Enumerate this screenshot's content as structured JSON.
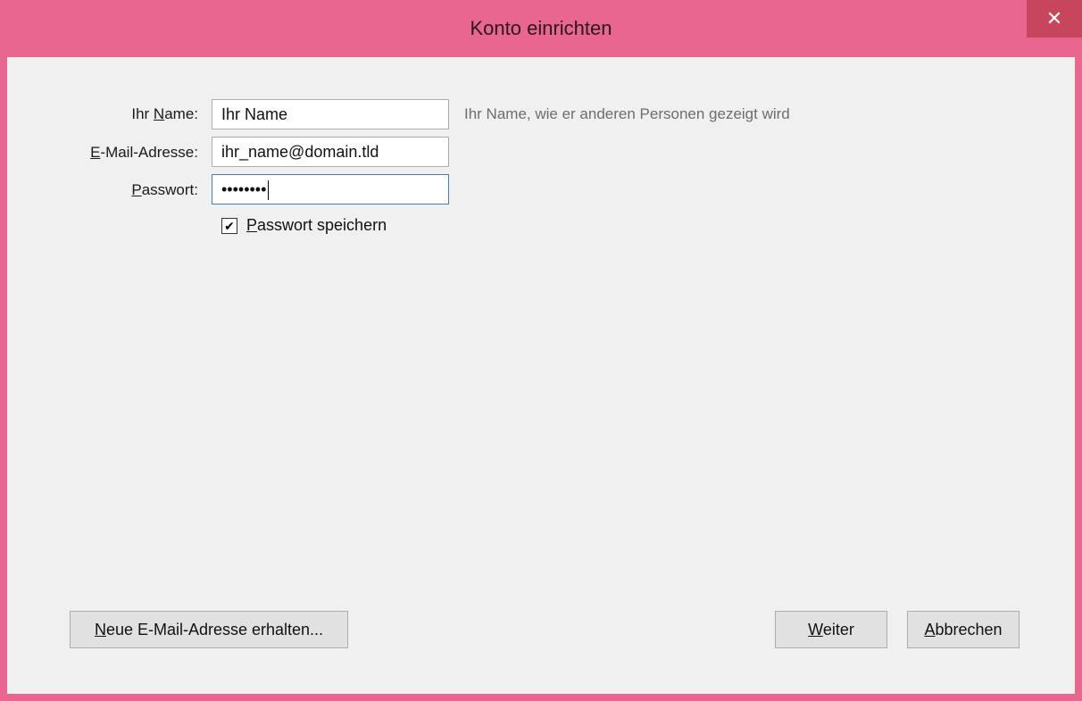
{
  "window": {
    "title": "Konto einrichten",
    "close_symbol": "✕"
  },
  "form": {
    "name_label_pre": "Ihr ",
    "name_label_key": "N",
    "name_label_post": "ame:",
    "name_value": "Ihr Name",
    "name_hint": "Ihr Name, wie er anderen Personen gezeigt wird",
    "email_label_key": "E",
    "email_label_post": "-Mail-Adresse:",
    "email_value": "ihr_name@domain.tld",
    "password_label_key": "P",
    "password_label_post": "asswort:",
    "password_value": "••••••••",
    "save_password_key": "P",
    "save_password_post": "asswort speichern",
    "save_password_checked": true,
    "checkmark": "✔"
  },
  "buttons": {
    "new_email_key": "N",
    "new_email_post": "eue E-Mail-Adresse erhalten...",
    "next_key": "W",
    "next_post": "eiter",
    "cancel_key": "A",
    "cancel_post": "bbrechen"
  },
  "colors": {
    "titlebar": "#e8668f",
    "close_button": "#c8455e",
    "client": "#f0f0f0"
  }
}
